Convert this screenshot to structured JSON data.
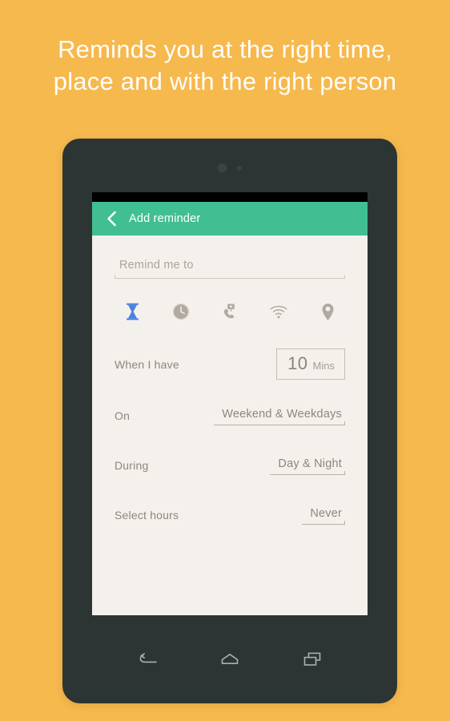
{
  "promo": {
    "headline_line1": "Reminds you at the right time,",
    "headline_line2": "place and with the right person",
    "background_color": "#f6b94e",
    "headline_color": "#fdfdfb"
  },
  "device": {
    "frame_color": "#2c3533",
    "camera_icon": "camera-lens-dot",
    "sensor_icon": "sensor-dot"
  },
  "app": {
    "accent_color": "#41bf92",
    "screen_background": "#f4f1ec",
    "appbar": {
      "back_icon": "chevron-left-icon",
      "title": "Add reminder"
    },
    "reminder_input": {
      "placeholder": "Remind me to",
      "value": ""
    },
    "trigger_tabs": [
      {
        "icon": "hourglass-icon",
        "name": "duration",
        "active": true,
        "color": "#4a82e0"
      },
      {
        "icon": "clock-icon",
        "name": "time",
        "active": false,
        "color": "#b0aaa2"
      },
      {
        "icon": "phone-call-icon",
        "name": "call",
        "active": false,
        "color": "#b0aaa2"
      },
      {
        "icon": "wifi-icon",
        "name": "wifi",
        "active": false,
        "color": "#b0aaa2"
      },
      {
        "icon": "location-pin-icon",
        "name": "place",
        "active": false,
        "color": "#b0aaa2"
      }
    ],
    "settings": {
      "when_label": "When I have",
      "duration_value": "10",
      "duration_unit": "Mins",
      "on_label": "On",
      "on_value": "Weekend & Weekdays",
      "during_label": "During",
      "during_value": "Day & Night",
      "hours_label": "Select hours",
      "hours_value": "Never"
    }
  },
  "navbar": {
    "back_icon": "nav-back-icon",
    "home_icon": "nav-home-icon",
    "recents_icon": "nav-recents-icon"
  }
}
